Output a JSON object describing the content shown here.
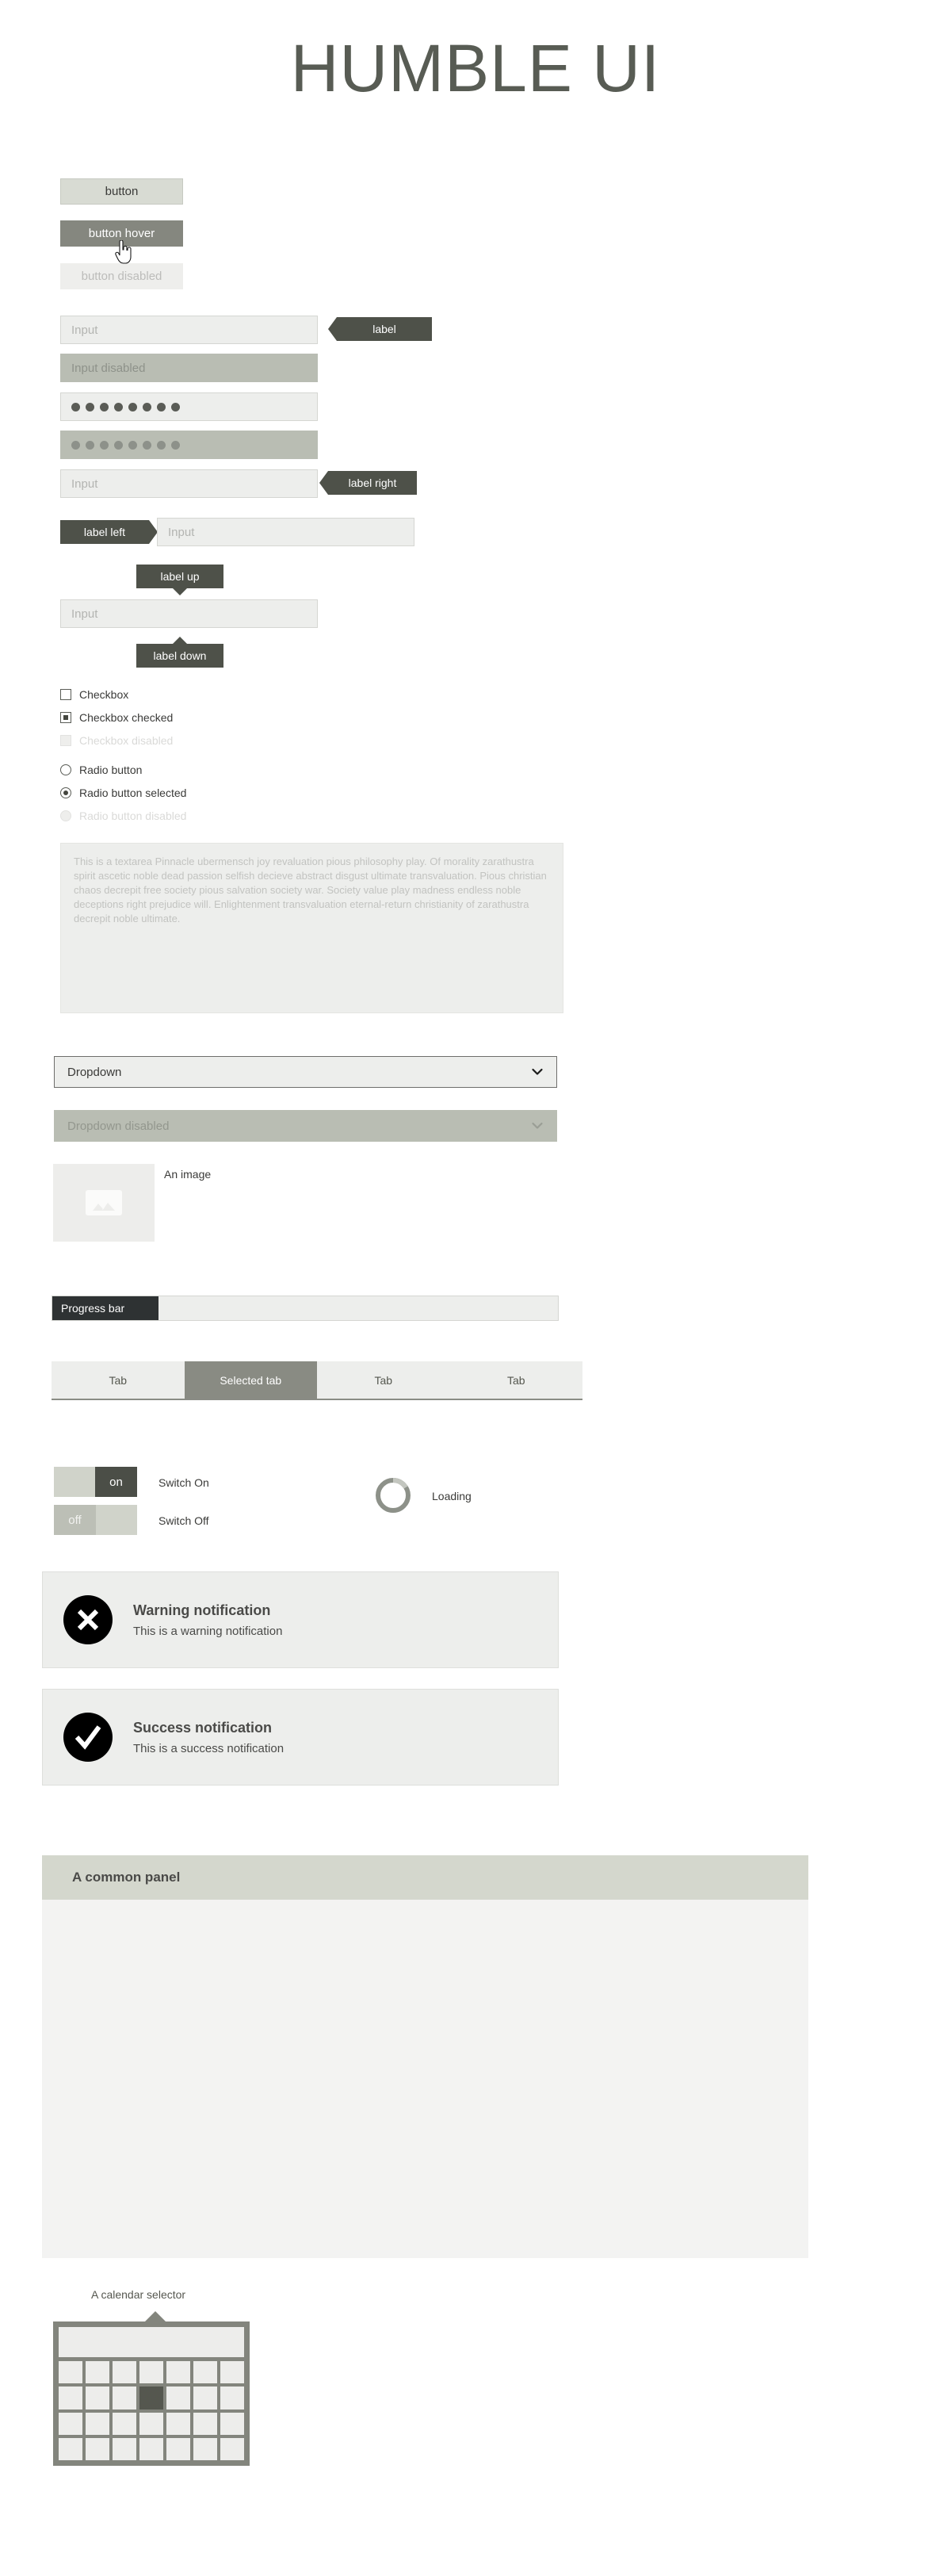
{
  "page": {
    "title": "HUMBLE UI",
    "accent_dark": "#4e5149",
    "accent_muted": "#85877f",
    "surface": "#edeeec",
    "disabled": "#b9bdb3"
  },
  "buttons": {
    "default_label": "button",
    "hover_label": "button hover",
    "disabled_label": "button disabled"
  },
  "cursor": {
    "icon": "hand-pointer-cursor"
  },
  "inputs": {
    "input_placeholder": "Input",
    "input_disabled_placeholder": "Input disabled",
    "password_dots": 8,
    "password_disabled_dots": 8,
    "input_right_placeholder": "Input",
    "input_left_placeholder": "Input",
    "input_updown_placeholder": "Input"
  },
  "tags": {
    "label": "label",
    "label_right": "label right",
    "label_left": "label left",
    "label_up": "label up",
    "label_down": "label down"
  },
  "checkboxes": [
    {
      "label": "Checkbox",
      "state": "unchecked"
    },
    {
      "label": "Checkbox checked",
      "state": "checked"
    },
    {
      "label": "Checkbox disabled",
      "state": "disabled"
    }
  ],
  "radios": [
    {
      "label": "Radio button",
      "state": "unselected"
    },
    {
      "label": "Radio button selected",
      "state": "selected"
    },
    {
      "label": "Radio button disabled",
      "state": "disabled"
    }
  ],
  "textarea": {
    "value": "This is a textarea Pinnacle ubermensch joy revaluation pious philosophy play. Of morality zarathustra spirit ascetic noble dead passion selfish decieve abstract disgust ultimate transvaluation. Pious christian chaos decrepit free society pious salvation society war. Society value play madness endless noble deceptions right prejudice will. Enlightenment transvaluation eternal-return christianity of zarathustra decrepit noble ultimate."
  },
  "dropdowns": {
    "enabled_value": "Dropdown",
    "disabled_value": "Dropdown disabled",
    "chevron_icon": "chevron-down-icon"
  },
  "image": {
    "caption": "An image",
    "placeholder_icon": "image-placeholder-icon"
  },
  "progress": {
    "label": "Progress bar",
    "percent": 21
  },
  "tabs": [
    {
      "label": "Tab",
      "selected": false
    },
    {
      "label": "Selected tab",
      "selected": true
    },
    {
      "label": "Tab",
      "selected": false
    },
    {
      "label": "Tab",
      "selected": false
    }
  ],
  "switches": {
    "on_knob": "on",
    "on_label": "Switch On",
    "off_knob": "off",
    "off_label": "Switch Off"
  },
  "loading": {
    "label": "Loading",
    "icon": "spinner-icon"
  },
  "notifications": [
    {
      "icon": "error-circle-x-icon",
      "title": "Warning notification",
      "message": "This is a warning notification"
    },
    {
      "icon": "success-circle-check-icon",
      "title": "Success notification",
      "message": "This is a success notification"
    }
  ],
  "panel": {
    "title": "A common panel",
    "header_color": "#d4d7cd",
    "body_color": "#f3f3f2"
  },
  "calendar": {
    "label": "A calendar selector",
    "columns": 7,
    "rows": 4,
    "selected_row": 2,
    "selected_col": 4,
    "frame_color": "#83857d",
    "cell_color": "#ededeb",
    "selected_color": "#55574f"
  }
}
